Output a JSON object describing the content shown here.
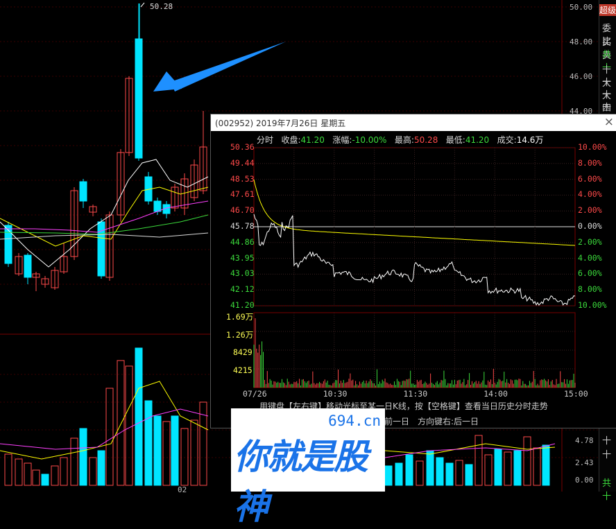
{
  "kline": {
    "price_axis": [
      "50.00",
      "48.00",
      "46.00",
      "44.00"
    ],
    "peak_label": "50.28",
    "vol_axis": [
      "4.78",
      "2.43",
      "0.00"
    ],
    "bottom_date": "02"
  },
  "right_panel": {
    "items": [
      {
        "text": "超级",
        "color": "#fff",
        "bg": "#c0392b"
      },
      {
        "text": "委比",
        "color": "#ccc"
      },
      {
        "text": "买卖",
        "color": "#ccc"
      },
      {
        "text": "共十",
        "color": "#3cdc3c"
      },
      {
        "text": "十大",
        "color": "#ccc"
      },
      {
        "text": "十大",
        "color": "#ccc"
      },
      {
        "text": "十四",
        "color": "#ccc"
      },
      {
        "text": "十大",
        "color": "#ccc"
      },
      {
        "text": "十",
        "color": "#ccc"
      },
      {
        "text": "十",
        "color": "#ccc"
      },
      {
        "text": "共十",
        "color": "#3cdc3c"
      }
    ]
  },
  "popup": {
    "title": "(002952) 2019年7月26日 星期五",
    "close": "×",
    "info": {
      "tab": "分时",
      "close_label": "收盘:",
      "close_val": "41.20",
      "chg_label": "涨幅:",
      "chg_val": "-10.00%",
      "high_label": "最高:",
      "high_val": "50.28",
      "low_label": "最低:",
      "low_val": "41.20",
      "vol_label": "成交:",
      "vol_val": "14.6万"
    },
    "price_labels_left": [
      "50.36",
      "49.44",
      "48.53",
      "47.61",
      "46.70",
      "45.78",
      "44.86",
      "43.95",
      "43.03",
      "42.12",
      "41.20"
    ],
    "pct_labels_right": [
      "10.00%",
      "8.00%",
      "6.00%",
      "4.00%",
      "2.00%",
      "0.00%",
      "2.00%",
      "4.00%",
      "6.00%",
      "8.00%",
      "10.00%"
    ],
    "vol_labels_left": [
      "1.69万",
      "1.26万",
      "8429",
      "4215"
    ],
    "time_labels": [
      "07/26",
      "10:30",
      "11:30",
      "14:00",
      "15:00"
    ],
    "hint1": "用键盘【左右键】移动光标至某一日K线，按【空格键】查看当日历史分时走势",
    "hint2": "前一日　方向键右:后一日"
  },
  "watermark": {
    "site": "694.cn",
    "text": "你就是股神"
  },
  "colors": {
    "up": "#ff4a4a",
    "down": "#00e5ff",
    "ma5": "#ffffff",
    "ma10": "#ffff00",
    "ma20": "#ff40ff",
    "ma60": "#3cdc3c",
    "arrow": "#1e90ff"
  }
}
